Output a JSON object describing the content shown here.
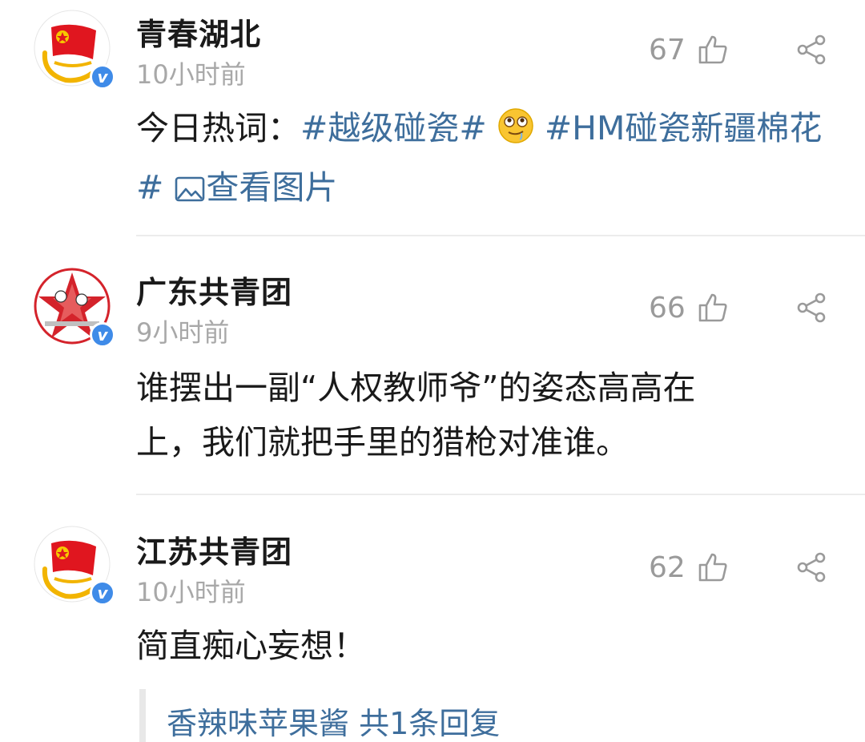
{
  "comments": [
    {
      "author": "青春湖北",
      "time": "10小时前",
      "likes": "67",
      "verified": "v",
      "avatar_icon": "youth-league-flag-icon",
      "text_prefix": "今日热词：",
      "hashtag1": "#越级碰瓷#",
      "hashtag2": "#HM碰瓷新疆棉花#",
      "view_image_label": "查看图片"
    },
    {
      "author": "广东共青团",
      "time": "9小时前",
      "likes": "66",
      "verified": "v",
      "avatar_icon": "red-star-avatar-icon",
      "text_line1": "谁摆出一副“人权教师爷”的姿态高高在",
      "text_line2": "上，我们就把手里的猎枪对准谁。"
    },
    {
      "author": "江苏共青团",
      "time": "10小时前",
      "likes": "62",
      "verified": "v",
      "avatar_icon": "youth-league-flag-icon",
      "text": "简直痴心妄想！",
      "reply_link": "香辣味苹果酱 共1条回复"
    }
  ],
  "colors": {
    "link": "#3e6e9c",
    "author": "#1a1a1a",
    "meta": "#a8a8a8",
    "verified_badge": "#3f8be8"
  }
}
